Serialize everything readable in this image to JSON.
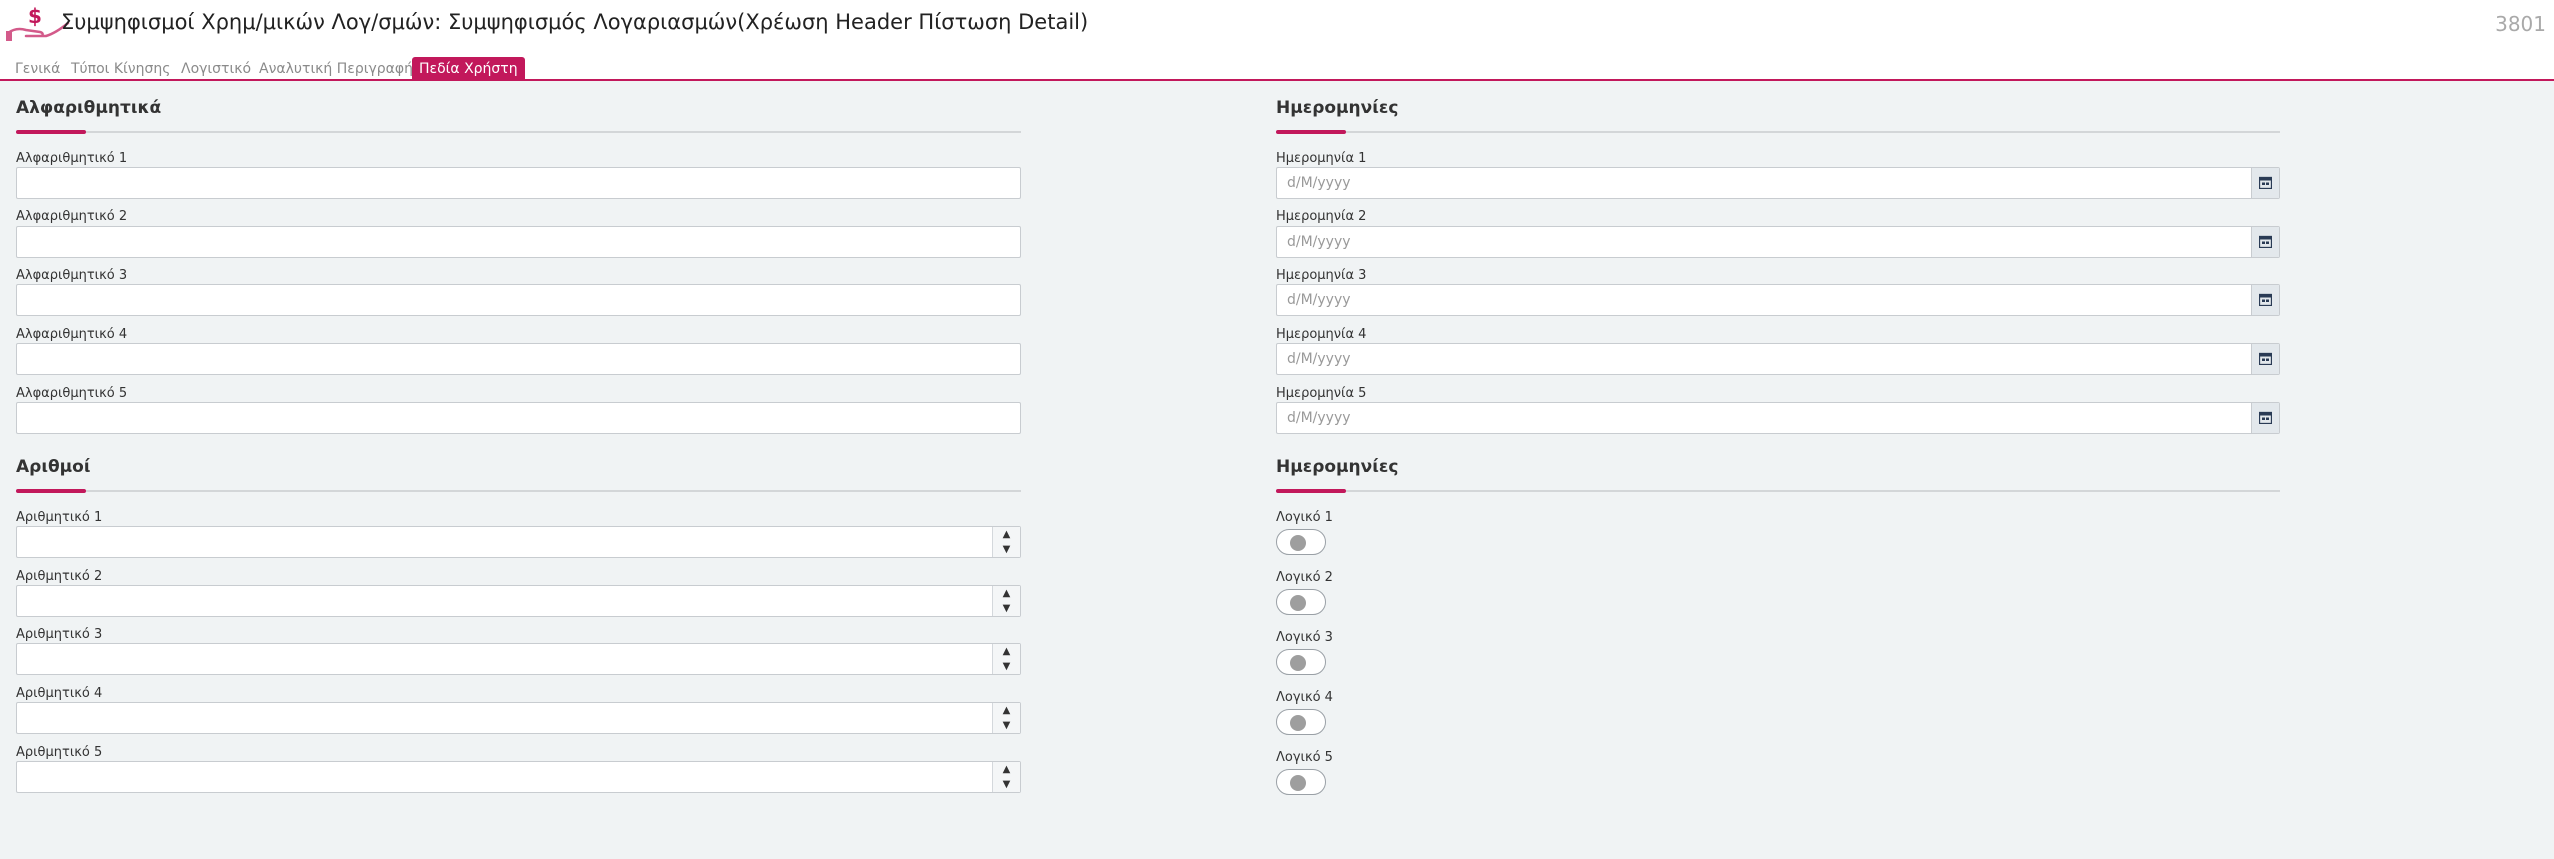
{
  "header": {
    "title": "Συμψηφισμοί Χρημ/μικών Λογ/σμών: Συμψηφισμός Λογαριασμών(Χρέωση Header Πίστωση Detail)",
    "record_id": "3801",
    "logo_icon": "dollar-hand-icon",
    "accent_color": "#c2185b"
  },
  "tabs": [
    {
      "label": "Γενικά",
      "active": false
    },
    {
      "label": "Τύποι Κίνησης",
      "active": false
    },
    {
      "label": "Λογιστικό",
      "active": false
    },
    {
      "label": "Αναλυτική Περιγραφή",
      "active": false
    },
    {
      "label": "Πεδία Χρήστη",
      "active": true
    }
  ],
  "sections": {
    "alpha": {
      "title": "Αλφαριθμητικά",
      "fields": [
        {
          "label": "Αλφαριθμητικό 1",
          "value": ""
        },
        {
          "label": "Αλφαριθμητικό 2",
          "value": ""
        },
        {
          "label": "Αλφαριθμητικό 3",
          "value": ""
        },
        {
          "label": "Αλφαριθμητικό 4",
          "value": ""
        },
        {
          "label": "Αλφαριθμητικό 5",
          "value": ""
        }
      ]
    },
    "dates": {
      "title": "Ημερομηνίες",
      "fields": [
        {
          "label": "Ημερομηνία 1",
          "placeholder": "d/M/yyyy"
        },
        {
          "label": "Ημερομηνία 2",
          "placeholder": "d/M/yyyy"
        },
        {
          "label": "Ημερομηνία 3",
          "placeholder": "d/M/yyyy"
        },
        {
          "label": "Ημερομηνία 4",
          "placeholder": "d/M/yyyy"
        },
        {
          "label": "Ημερομηνία 5",
          "placeholder": "d/M/yyyy"
        }
      ]
    },
    "numbers": {
      "title": "Αριθμοί",
      "spin_up": "▲",
      "spin_down": "▼",
      "fields": [
        {
          "label": "Αριθμητικό 1",
          "value": ""
        },
        {
          "label": "Αριθμητικό 2",
          "value": ""
        },
        {
          "label": "Αριθμητικό 3",
          "value": ""
        },
        {
          "label": "Αριθμητικό 4",
          "value": ""
        },
        {
          "label": "Αριθμητικό 5",
          "value": ""
        }
      ]
    },
    "booleans": {
      "title": "Ημερομηνίες",
      "fields": [
        {
          "label": "Λογικό 1",
          "checked": false
        },
        {
          "label": "Λογικό 2",
          "checked": false
        },
        {
          "label": "Λογικό 3",
          "checked": false
        },
        {
          "label": "Λογικό 4",
          "checked": false
        },
        {
          "label": "Λογικό 5",
          "checked": false
        }
      ]
    }
  }
}
